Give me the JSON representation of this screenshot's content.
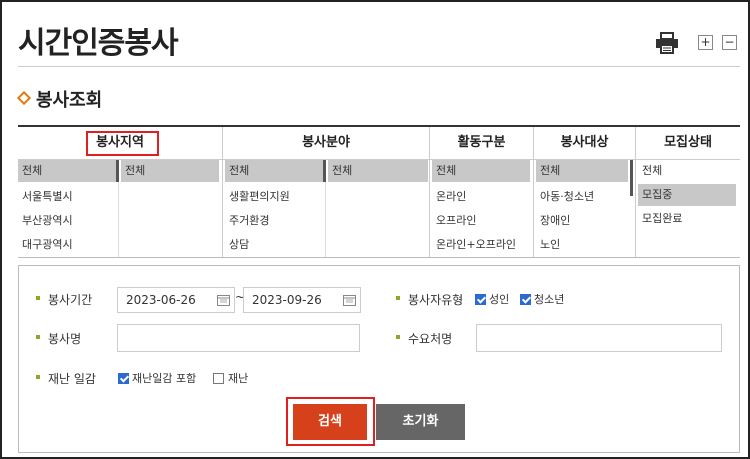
{
  "header": {
    "title": "시간인증봉사",
    "print_icon": "printer-icon",
    "zoom_in_label": "+",
    "zoom_out_label": "−"
  },
  "section": {
    "title": "봉사조회"
  },
  "filters": {
    "region": {
      "header": "봉사지역",
      "col1": [
        "전체",
        "서울특별시",
        "부산광역시",
        "대구광역시"
      ],
      "col1_selected": "전체",
      "col2": [
        "전체"
      ],
      "col2_selected": "전체"
    },
    "field": {
      "header": "봉사분야",
      "col1": [
        "전체",
        "생활편의지원",
        "주거환경",
        "상담"
      ],
      "col1_selected": "전체",
      "col2": [
        "전체"
      ],
      "col2_selected": "전체"
    },
    "activity": {
      "header": "활동구분",
      "items": [
        "전체",
        "온라인",
        "오프라인",
        "온라인+오프라인"
      ],
      "selected": "전체"
    },
    "target": {
      "header": "봉사대상",
      "items": [
        "전체",
        "아동·청소년",
        "장애인",
        "노인"
      ],
      "selected": "전체"
    },
    "status": {
      "header": "모집상태",
      "items": [
        "전체",
        "모집중",
        "모집완료"
      ],
      "selected": "모집중"
    }
  },
  "search": {
    "period_label": "봉사기간",
    "start_date": "2023-06-26",
    "end_date": "2023-09-26",
    "tilde": "~",
    "type_label": "봉사자유형",
    "type_adult": "성인",
    "type_youth": "청소년",
    "type_adult_checked": true,
    "type_youth_checked": true,
    "name_label": "봉사명",
    "name_value": "",
    "org_label": "수요처명",
    "org_value": "",
    "disaster_label": "재난 일감",
    "disaster_include": "재난일감 포함",
    "disaster_only": "재난",
    "disaster_include_checked": true,
    "disaster_only_checked": false,
    "search_button": "검색",
    "reset_button": "초기화"
  },
  "colors": {
    "accent": "#d6401a",
    "highlight": "#e02020",
    "bullet": "#8aa82a",
    "section_icon": "#e07b12"
  }
}
